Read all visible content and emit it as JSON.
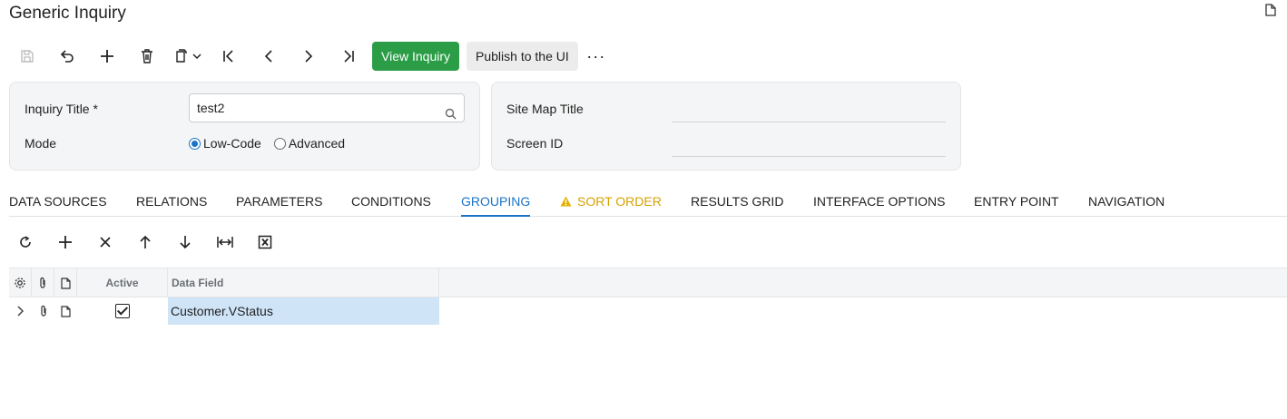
{
  "page": {
    "title": "Generic Inquiry"
  },
  "toolbar": {
    "icons": [
      "save-icon",
      "undo-icon",
      "add-icon",
      "delete-icon",
      "copy-paste-icon",
      "first-record-icon",
      "previous-icon",
      "next-icon",
      "last-record-icon"
    ],
    "view_inquiry": "View Inquiry",
    "publish": "Publish to the UI",
    "more": "···"
  },
  "form": {
    "inquiry_title_label": "Inquiry Title",
    "required_mark": "*",
    "inquiry_title_value": "test2",
    "mode_label": "Mode",
    "mode_options": [
      {
        "label": "Low-Code",
        "selected": true
      },
      {
        "label": "Advanced",
        "selected": false
      }
    ],
    "site_map_title_label": "Site Map Title",
    "site_map_title_value": "",
    "screen_id_label": "Screen ID",
    "screen_id_value": ""
  },
  "tabs": [
    {
      "label": "DATA SOURCES",
      "state": "normal"
    },
    {
      "label": "RELATIONS",
      "state": "normal"
    },
    {
      "label": "PARAMETERS",
      "state": "normal"
    },
    {
      "label": "CONDITIONS",
      "state": "normal"
    },
    {
      "label": "GROUPING",
      "state": "active"
    },
    {
      "label": "SORT ORDER",
      "state": "warning"
    },
    {
      "label": "RESULTS GRID",
      "state": "normal"
    },
    {
      "label": "INTERFACE OPTIONS",
      "state": "normal"
    },
    {
      "label": "ENTRY POINT",
      "state": "normal"
    },
    {
      "label": "NAVIGATION",
      "state": "normal"
    }
  ],
  "grid_toolbar": {
    "icons": [
      "refresh-icon",
      "add-row-icon",
      "delete-row-icon",
      "move-up-icon",
      "move-down-icon",
      "fit-columns-icon",
      "export-excel-icon"
    ]
  },
  "grid": {
    "columns": {
      "settings": "settings-icon",
      "attachments": "paperclip-icon",
      "notes": "note-icon",
      "active": "Active",
      "data_field": "Data Field"
    },
    "rows": [
      {
        "active": true,
        "data_field": "Customer.VStatus"
      }
    ]
  },
  "colors": {
    "accent": "#1a73c7",
    "primary_button": "#2a9d46",
    "warning": "#d8a100",
    "selected_cell": "#cfe4f7"
  }
}
